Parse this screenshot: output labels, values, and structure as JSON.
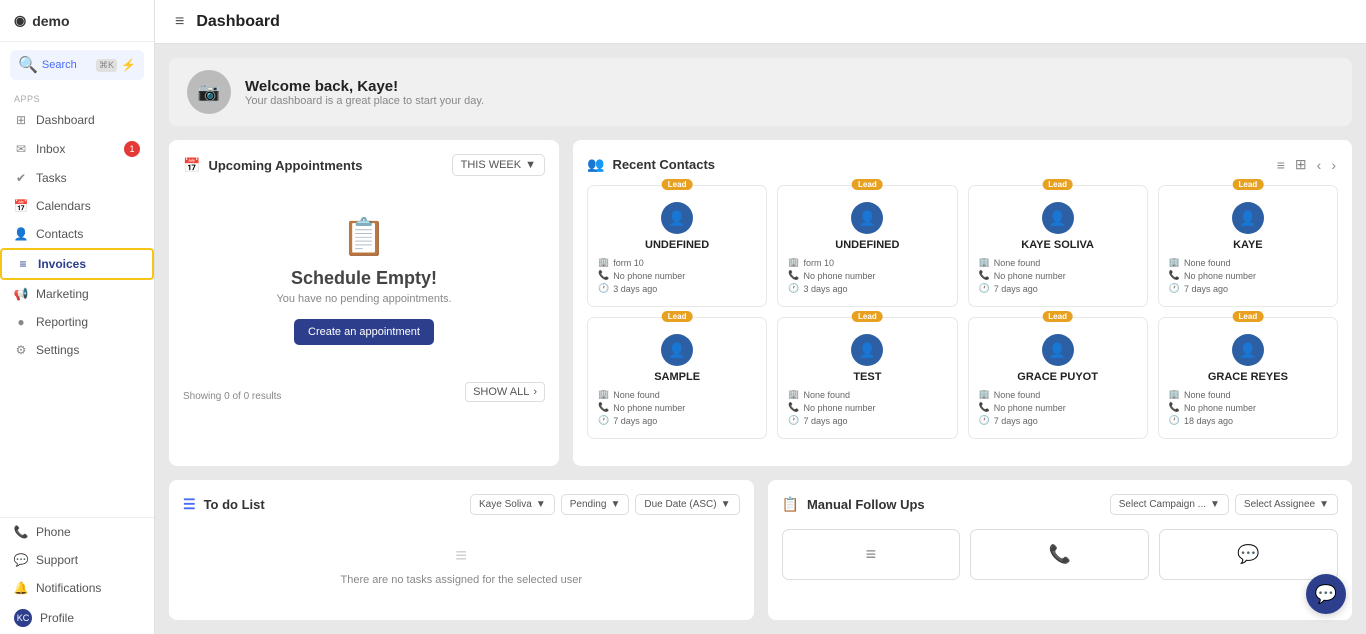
{
  "app": {
    "name": "demo",
    "page_title": "Dashboard"
  },
  "sidebar": {
    "search_label": "Search",
    "search_kbd": "⌘K",
    "sections": {
      "apps_label": "Apps"
    },
    "items": [
      {
        "id": "dashboard",
        "label": "Dashboard",
        "icon": "⊞",
        "active": false,
        "badge": null
      },
      {
        "id": "inbox",
        "label": "Inbox",
        "icon": "✉",
        "active": false,
        "badge": "1"
      },
      {
        "id": "tasks",
        "label": "Tasks",
        "icon": "✓",
        "active": false,
        "badge": null
      },
      {
        "id": "calendars",
        "label": "Calendars",
        "icon": "📅",
        "active": false,
        "badge": null
      },
      {
        "id": "contacts",
        "label": "Contacts",
        "icon": "👤",
        "active": false,
        "badge": null
      },
      {
        "id": "invoices",
        "label": "Invoices",
        "icon": "≡",
        "active": true,
        "badge": null
      },
      {
        "id": "marketing",
        "label": "Marketing",
        "icon": "📢",
        "active": false,
        "badge": null
      },
      {
        "id": "reporting",
        "label": "Reporting",
        "icon": "📊",
        "active": false,
        "badge": null
      },
      {
        "id": "settings",
        "label": "Settings",
        "icon": "⚙",
        "active": false,
        "badge": null
      }
    ],
    "bottom_items": [
      {
        "id": "phone",
        "label": "Phone",
        "icon": "📞"
      },
      {
        "id": "support",
        "label": "Support",
        "icon": "💬"
      },
      {
        "id": "notifications",
        "label": "Notifications",
        "icon": "🔔"
      },
      {
        "id": "profile",
        "label": "Profile",
        "icon": "KC",
        "initials": true
      }
    ]
  },
  "topbar": {
    "menu_icon": "≡",
    "title": "Dashboard"
  },
  "welcome": {
    "heading": "Welcome back, Kaye!",
    "subtext": "Your dashboard is a great place to start your day."
  },
  "appointments": {
    "title": "Upcoming Appointments",
    "filter_label": "THIS WEEK",
    "empty_heading": "Schedule Empty!",
    "empty_subtext": "You have no pending appointments.",
    "create_btn": "Create an appointment",
    "showing": "Showing 0 of 0 results",
    "show_all": "SHOW ALL"
  },
  "recent_contacts": {
    "title": "Recent Contacts",
    "contacts": [
      {
        "name": "UNDEFINED",
        "badge": "Lead",
        "detail1": "form 10",
        "detail2": "No phone number",
        "detail3": "3 days ago"
      },
      {
        "name": "UNDEFINED",
        "badge": "Lead",
        "detail1": "form 10",
        "detail2": "No phone number",
        "detail3": "3 days ago"
      },
      {
        "name": "KAYE SOLIVA",
        "badge": "Lead",
        "detail1": "None found",
        "detail2": "No phone number",
        "detail3": "7 days ago"
      },
      {
        "name": "KAYE",
        "badge": "Lead",
        "detail1": "None found",
        "detail2": "No phone number",
        "detail3": "7 days ago"
      },
      {
        "name": "SAMPLE",
        "badge": "Lead",
        "detail1": "None found",
        "detail2": "No phone number",
        "detail3": "7 days ago"
      },
      {
        "name": "TEST",
        "badge": "Lead",
        "detail1": "None found",
        "detail2": "No phone number",
        "detail3": "7 days ago"
      },
      {
        "name": "GRACE PUYOT",
        "badge": "Lead",
        "detail1": "None found",
        "detail2": "No phone number",
        "detail3": "7 days ago"
      },
      {
        "name": "GRACE REYES",
        "badge": "Lead",
        "detail1": "None found",
        "detail2": "No phone number",
        "detail3": "18 days ago"
      }
    ]
  },
  "todo": {
    "title": "To do List",
    "filter_assignee": "Kaye Soliva",
    "filter_status": "Pending",
    "filter_sort": "Due Date (ASC)",
    "empty_text": "There are no tasks assigned for the selected user"
  },
  "manual_followups": {
    "title": "Manual Follow Ups",
    "select_campaign": "Select Campaign ...",
    "select_assignee": "Select Assignee"
  },
  "chat_fab_icon": "💬"
}
